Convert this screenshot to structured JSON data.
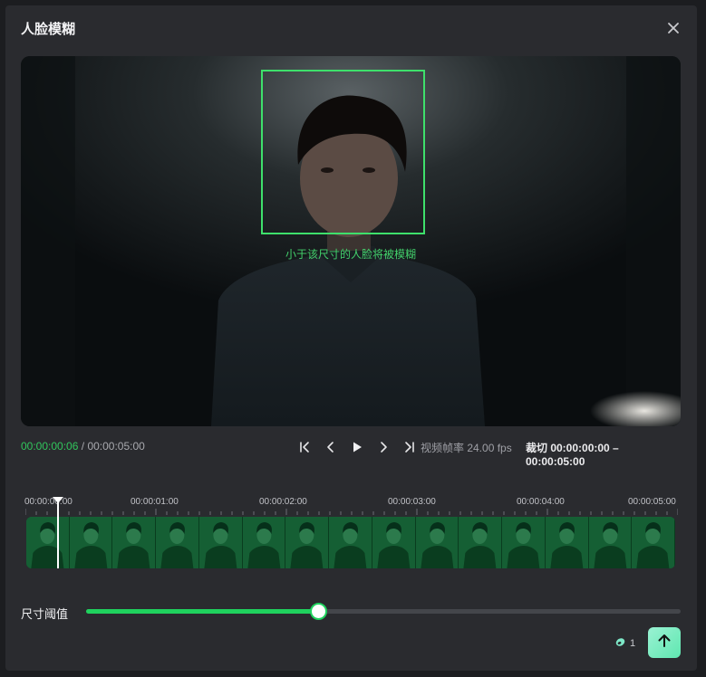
{
  "dialog": {
    "title": "人脸模糊",
    "close_icon": "close-icon"
  },
  "preview": {
    "face_hint": "小于该尺寸的人脸将被模糊",
    "face_box_color": "#3ee06b"
  },
  "playback": {
    "current_time": "00:00:00:06",
    "separator": "/",
    "total_time": "00:00:05:00",
    "controls": [
      "skip-to-start-icon",
      "prev-frame-icon",
      "play-icon",
      "next-frame-icon",
      "skip-to-end-icon"
    ],
    "fps": "视频帧率 24.00 fps",
    "crop": "裁切 00:00:00:00 – 00:00:05:00"
  },
  "timeline": {
    "labels": [
      "00:00:00:00",
      "00:00:01:00",
      "00:00:02:00",
      "00:00:03:00",
      "00:00:04:00",
      "00:00:05:00"
    ],
    "frame_count": 15,
    "playhead_fraction": 0.05
  },
  "threshold": {
    "label": "尺寸阈值",
    "value_fraction": 0.39
  },
  "footer": {
    "credit_icon": "coin-icon",
    "credit_count": "1",
    "submit_icon": "arrow-up-icon"
  },
  "colors": {
    "accent": "#1fd25e",
    "background": "#2a2b2f",
    "timeline_green": "#0d4d26"
  }
}
